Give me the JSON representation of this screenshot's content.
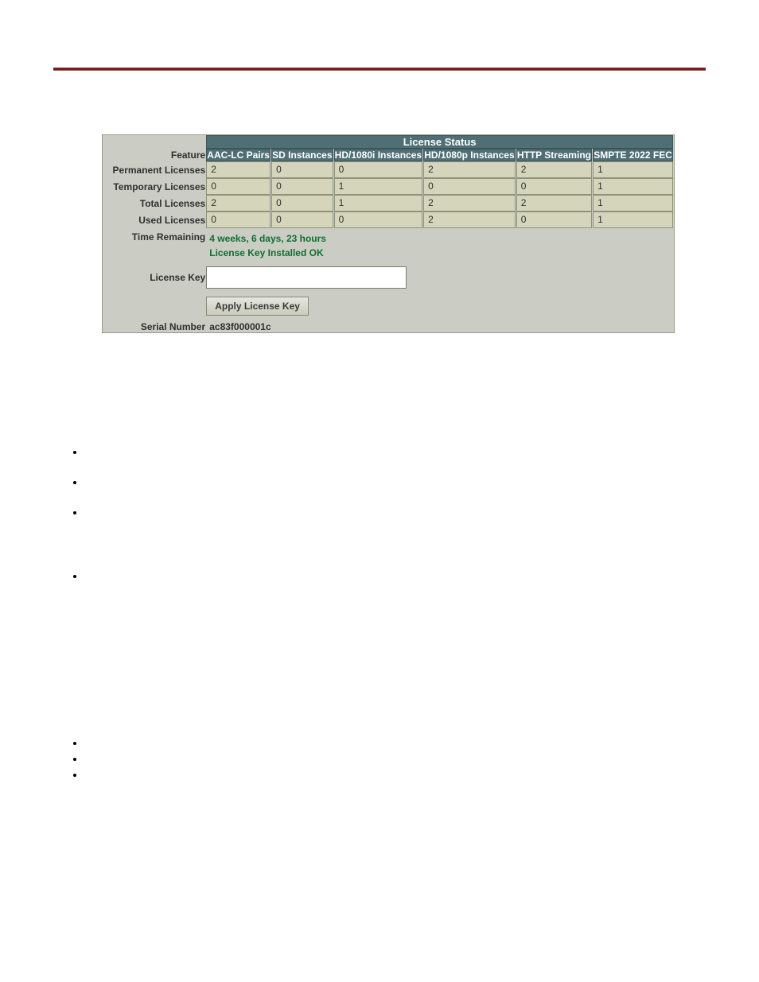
{
  "table": {
    "title": "License Status",
    "feature_label": "Feature",
    "columns": [
      {
        "key": "aac",
        "label": "AAC-LC Pairs"
      },
      {
        "key": "sd",
        "label": "SD Instances"
      },
      {
        "key": "hd1080i",
        "label": "HD/1080i Instances"
      },
      {
        "key": "hd1080p",
        "label": "HD/1080p Instances"
      },
      {
        "key": "http",
        "label": "HTTP Streaming"
      },
      {
        "key": "smpte",
        "label": "SMPTE 2022 FEC"
      }
    ],
    "rows": [
      {
        "label": "Permanent Licenses",
        "values": {
          "aac": "2",
          "sd": "0",
          "hd1080i": "0",
          "hd1080p": "2",
          "http": "2",
          "smpte": "1"
        }
      },
      {
        "label": "Temporary Licenses",
        "values": {
          "aac": "0",
          "sd": "0",
          "hd1080i": "1",
          "hd1080p": "0",
          "http": "0",
          "smpte": "1"
        }
      },
      {
        "label": "Total Licenses",
        "values": {
          "aac": "2",
          "sd": "0",
          "hd1080i": "1",
          "hd1080p": "2",
          "http": "2",
          "smpte": "1"
        }
      },
      {
        "label": "Used Licenses",
        "values": {
          "aac": "0",
          "sd": "0",
          "hd1080i": "0",
          "hd1080p": "2",
          "http": "0",
          "smpte": "1"
        }
      }
    ],
    "time_remaining": {
      "label": "Time Remaining",
      "value": "4 weeks, 6 days, 23 hours"
    },
    "install_status": "License Key Installed OK",
    "license_key": {
      "label": "License Key",
      "value": ""
    },
    "apply_button": "Apply License Key",
    "serial": {
      "label": "Serial Number",
      "value": "ac83f000001c"
    }
  }
}
